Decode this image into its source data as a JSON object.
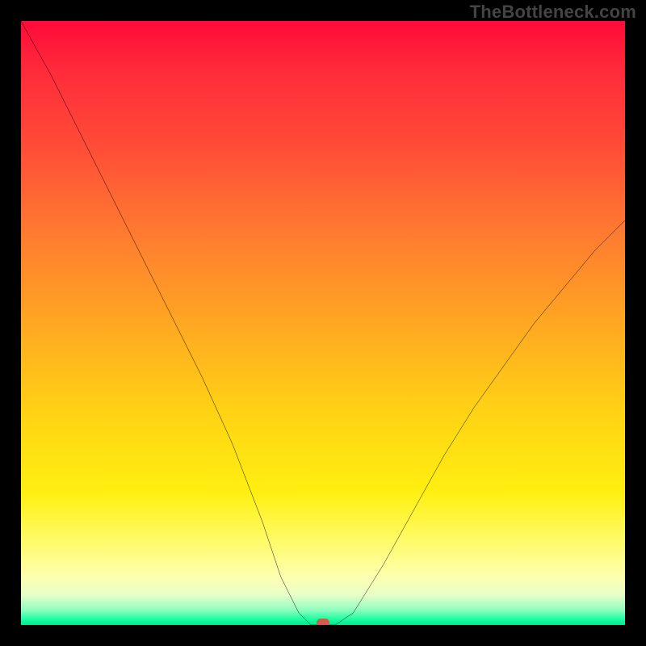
{
  "watermark": "TheBottleneck.com",
  "colors": {
    "top": "#ff0a3a",
    "mid": "#ffd314",
    "bottom": "#00e890",
    "curve": "#000000",
    "marker": "#d65a4a",
    "background": "#000000"
  },
  "chart_data": {
    "type": "line",
    "title": "",
    "xlabel": "",
    "ylabel": "",
    "xlim": [
      0,
      100
    ],
    "ylim": [
      0,
      100
    ],
    "grid": false,
    "legend": false,
    "note": "Bottleneck-style V-curve on a red→yellow→green vertical gradient. No tick labels are rendered on either axis; values below are pixel-read estimates on a 0–100 normalized scale.",
    "series": [
      {
        "name": "curve",
        "x": [
          0,
          5,
          10,
          15,
          20,
          25,
          30,
          35,
          40,
          43,
          46,
          48,
          50,
          52,
          55,
          60,
          65,
          70,
          75,
          80,
          85,
          90,
          95,
          100
        ],
        "y": [
          100,
          91,
          81,
          71,
          61,
          51,
          41,
          30,
          17,
          8,
          2,
          0,
          0,
          0,
          2,
          10,
          19,
          28,
          36,
          43,
          50,
          56,
          62,
          67
        ]
      }
    ],
    "marker": {
      "x": 50,
      "y": 0
    },
    "gradient_stops": [
      {
        "pos": 0,
        "color": "#ff0a3a"
      },
      {
        "pos": 0.35,
        "color": "#ff7a30"
      },
      {
        "pos": 0.65,
        "color": "#ffd314"
      },
      {
        "pos": 0.92,
        "color": "#fdffb0"
      },
      {
        "pos": 1,
        "color": "#00e890"
      }
    ]
  }
}
